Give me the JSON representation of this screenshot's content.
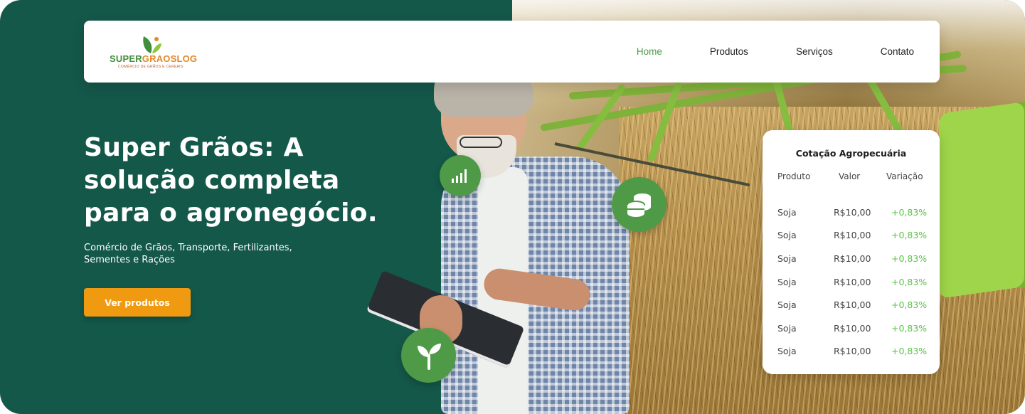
{
  "header": {
    "logo": {
      "brand_super": "SUPER",
      "brand_rest": "GRAOSLOG",
      "tagline": "COMÉRCIO DE GRÃOS E CEREAIS"
    },
    "nav": [
      {
        "label": "Home",
        "active": true
      },
      {
        "label": "Produtos",
        "active": false
      },
      {
        "label": "Serviços",
        "active": false
      },
      {
        "label": "Contato",
        "active": false
      }
    ]
  },
  "hero": {
    "title": "Super Grãos: A solução completa para o agronegócio.",
    "subtitle": "Comércio de Grãos, Transporte, Fertilizantes, Sementes e Rações",
    "cta_label": "Ver produtos"
  },
  "icons": [
    "bar-chart-icon",
    "coins-icon",
    "sprout-icon"
  ],
  "quote_card": {
    "title": "Cotação Agropecuária",
    "columns": [
      "Produto",
      "Valor",
      "Variação"
    ],
    "rows": [
      {
        "product": "Soja",
        "value": "R$10,00",
        "change": "+0,83%"
      },
      {
        "product": "Soja",
        "value": "R$10,00",
        "change": "+0,83%"
      },
      {
        "product": "Soja",
        "value": "R$10,00",
        "change": "+0,83%"
      },
      {
        "product": "Soja",
        "value": "R$10,00",
        "change": "+0,83%"
      },
      {
        "product": "Soja",
        "value": "R$10,00",
        "change": "+0,83%"
      },
      {
        "product": "Soja",
        "value": "R$10,00",
        "change": "+0,83%"
      },
      {
        "product": "Soja",
        "value": "R$10,00",
        "change": "+0,83%"
      }
    ]
  },
  "colors": {
    "background_green": "#14584a",
    "accent_green": "#4e9a4a",
    "positive": "#5cc24a",
    "cta": "#f09a12"
  }
}
